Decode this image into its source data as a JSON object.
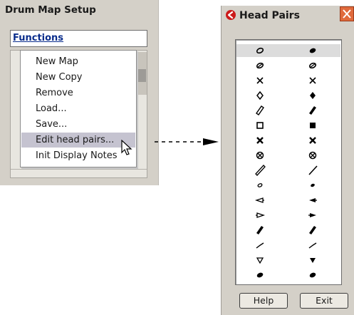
{
  "drum_map_setup": {
    "title": "Drum Map Setup",
    "functions_label": "Functions",
    "menu_items": [
      {
        "label": "New Map"
      },
      {
        "label": "New Copy"
      },
      {
        "label": "Remove"
      },
      {
        "label": "Load..."
      },
      {
        "label": "Save..."
      },
      {
        "label": "Edit head pairs..."
      },
      {
        "label": "Init Display Notes"
      }
    ],
    "highlighted_item": "Edit head pairs..."
  },
  "head_pairs": {
    "title": "Head Pairs",
    "close_icon": "close-x-icon",
    "help_label": "Help",
    "exit_label": "Exit",
    "rows": [
      {
        "left": "hollow-oval",
        "right": "filled-oval"
      },
      {
        "left": "slashed-oval",
        "right": "slashed-oval"
      },
      {
        "left": "x",
        "right": "x"
      },
      {
        "left": "hollow-diamond",
        "right": "filled-diamond"
      },
      {
        "left": "hollow-slash",
        "right": "filled-slash"
      },
      {
        "left": "hollow-square",
        "right": "filled-square"
      },
      {
        "left": "bold-x",
        "right": "bold-x"
      },
      {
        "left": "circled-x",
        "right": "circled-x"
      },
      {
        "left": "hollow-long-slash",
        "right": "long-slash"
      },
      {
        "left": "small-hollow-oval",
        "right": "small-filled-oval"
      },
      {
        "left": "hollow-triangle-left",
        "right": "filled-triangle-left"
      },
      {
        "left": "hollow-triangle-right",
        "right": "filled-triangle-right"
      },
      {
        "left": "filled-slash",
        "right": "filled-slash"
      },
      {
        "left": "thin-slash",
        "right": "thin-slash"
      },
      {
        "left": "hollow-triangle-down",
        "right": "filled-triangle-down"
      },
      {
        "left": "filled-oval",
        "right": "filled-oval"
      }
    ],
    "selected_row": 0
  },
  "colors": {
    "window_bg": "#d4d0c8",
    "functions_link": "#0a2d8c",
    "menu_highlight": "#c5c3d0",
    "close_button": "#e06a3c"
  }
}
